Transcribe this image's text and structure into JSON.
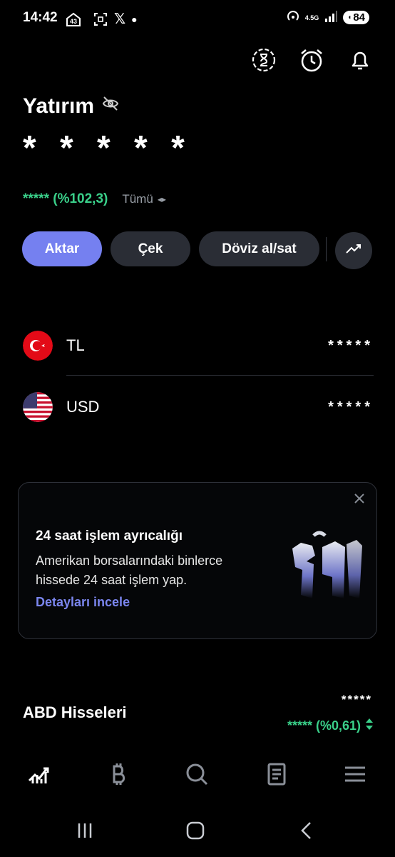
{
  "status_bar": {
    "time": "14:42",
    "badge_number": "43",
    "x_glyph": "𝕏",
    "network": "4.5G",
    "battery": "84"
  },
  "header": {
    "title": "Yatırım",
    "masked_total": "* * * * *",
    "masked_change": "***** (%102,3)",
    "filter_label": "Tümü"
  },
  "actions": {
    "transfer": "Aktar",
    "withdraw": "Çek",
    "fx": "Döviz al/sat"
  },
  "currencies": [
    {
      "label": "TL",
      "value": "*****"
    },
    {
      "label": "USD",
      "value": "*****"
    }
  ],
  "promo": {
    "title": "24 saat işlem ayrıcalığı",
    "body": "Amerikan borsalarındaki binlerce hissede 24 saat işlem yap.",
    "link": "Detayları incele"
  },
  "us_stocks": {
    "title": "ABD Hisseleri",
    "masked_value": "*****",
    "masked_change": "***** (%0,61)"
  },
  "colors": {
    "accent": "#7580f0",
    "positive": "#3ad08a",
    "button_bg": "#2a2d35"
  }
}
